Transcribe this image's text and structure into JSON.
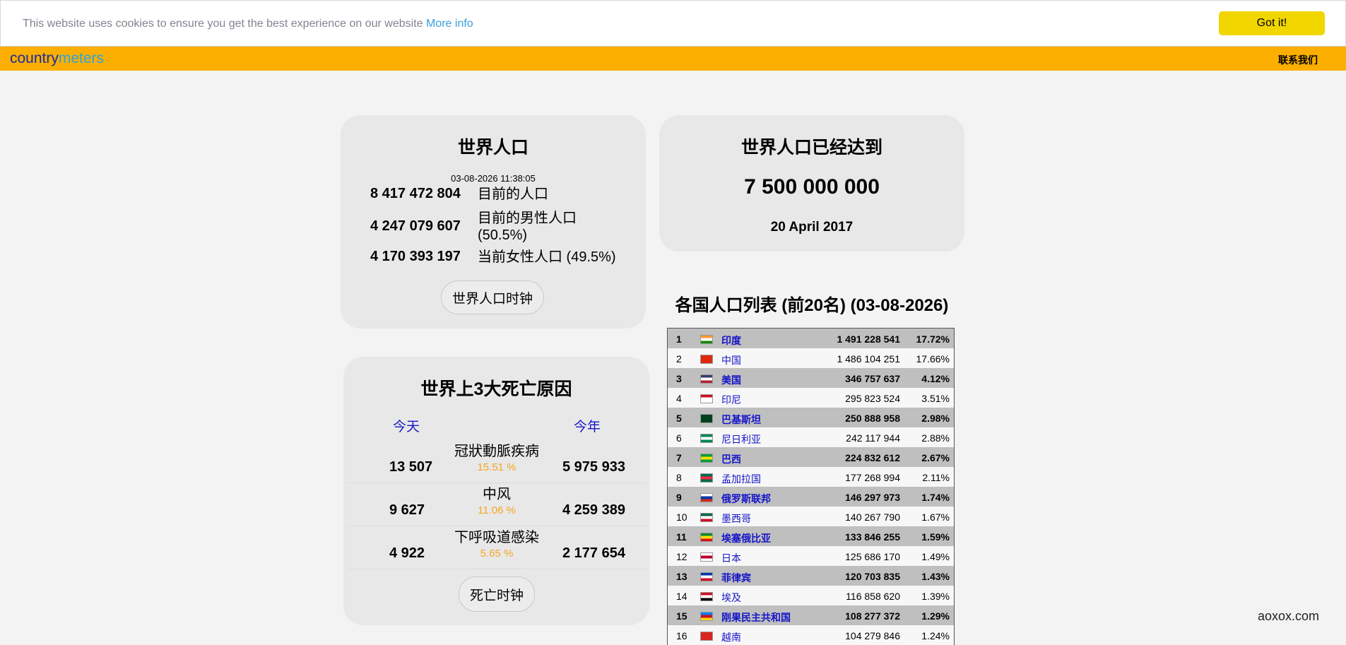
{
  "cookie": {
    "text": "This website uses cookies to ensure you get the best experience on our website",
    "more_info": "More info",
    "button": "Got it!"
  },
  "header": {
    "logo_part1": "country",
    "logo_part2": "meters",
    "contact": "联系我们"
  },
  "world_population": {
    "title": "世界人口",
    "datetime": "03-08-2026 11:38:05",
    "rows": [
      {
        "value": "8 417 472 804",
        "label": "目前的人口"
      },
      {
        "value": "4 247 079 607",
        "label": "目前的男性人口 (50.5%)"
      },
      {
        "value": "4 170 393 197",
        "label": "当前女性人口 (49.5%)"
      }
    ],
    "clock_button": "世界人口时钟"
  },
  "reached": {
    "title": "世界人口已经达到",
    "value": "7 500 000 000",
    "date": "20 April 2017"
  },
  "deaths": {
    "title": "世界上3大死亡原因",
    "today_label": "今天",
    "year_label": "今年",
    "causes": [
      {
        "name": "冠狀動脈疾病",
        "today": "13 507",
        "pct": "15.51 %",
        "year": "5 975 933"
      },
      {
        "name": "中风",
        "today": "9 627",
        "pct": "11.06 %",
        "year": "4 259 389"
      },
      {
        "name": "下呼吸道感染",
        "today": "4 922",
        "pct": "5.65 %",
        "year": "2 177 654"
      }
    ],
    "clock_button": "死亡时钟"
  },
  "country_list": {
    "title": "各国人口列表 (前20名) (03-08-2026)",
    "rows": [
      {
        "rank": "1",
        "flag": "india-flag",
        "name": "印度",
        "population": "1 491 228 541",
        "percent": "17.72%",
        "flag_colors": [
          "#ff9933",
          "#ffffff",
          "#138808"
        ]
      },
      {
        "rank": "2",
        "flag": "china-flag",
        "name": "中国",
        "population": "1 486 104 251",
        "percent": "17.66%",
        "flag_colors": [
          "#de2910",
          "#de2910",
          "#de2910"
        ]
      },
      {
        "rank": "3",
        "flag": "usa-flag",
        "name": "美国",
        "population": "346 757 637",
        "percent": "4.12%",
        "flag_colors": [
          "#3c3b6e",
          "#ffffff",
          "#b22234"
        ]
      },
      {
        "rank": "4",
        "flag": "indonesia-flag",
        "name": "印尼",
        "population": "295 823 524",
        "percent": "3.51%",
        "flag_colors": [
          "#ce1126",
          "#ffffff",
          "#ffffff"
        ]
      },
      {
        "rank": "5",
        "flag": "pakistan-flag",
        "name": "巴基斯坦",
        "population": "250 888 958",
        "percent": "2.98%",
        "flag_colors": [
          "#01411c",
          "#01411c",
          "#01411c"
        ]
      },
      {
        "rank": "6",
        "flag": "nigeria-flag",
        "name": "尼日利亚",
        "population": "242 117 944",
        "percent": "2.88%",
        "flag_colors": [
          "#008751",
          "#ffffff",
          "#008751"
        ]
      },
      {
        "rank": "7",
        "flag": "brazil-flag",
        "name": "巴西",
        "population": "224 832 612",
        "percent": "2.67%",
        "flag_colors": [
          "#009c3b",
          "#ffdf00",
          "#009c3b"
        ]
      },
      {
        "rank": "8",
        "flag": "bangladesh-flag",
        "name": "孟加拉国",
        "population": "177 268 994",
        "percent": "2.11%",
        "flag_colors": [
          "#006a4e",
          "#f42a41",
          "#006a4e"
        ]
      },
      {
        "rank": "9",
        "flag": "russia-flag",
        "name": "俄罗斯联邦",
        "population": "146 297 973",
        "percent": "1.74%",
        "flag_colors": [
          "#ffffff",
          "#0039a6",
          "#d52b1e"
        ]
      },
      {
        "rank": "10",
        "flag": "mexico-flag",
        "name": "墨西哥",
        "population": "140 267 790",
        "percent": "1.67%",
        "flag_colors": [
          "#006847",
          "#ffffff",
          "#ce1126"
        ]
      },
      {
        "rank": "11",
        "flag": "ethiopia-flag",
        "name": "埃塞俄比亚",
        "population": "133 846 255",
        "percent": "1.59%",
        "flag_colors": [
          "#078930",
          "#fcdd09",
          "#da121a"
        ]
      },
      {
        "rank": "12",
        "flag": "japan-flag",
        "name": "日本",
        "population": "125 686 170",
        "percent": "1.49%",
        "flag_colors": [
          "#ffffff",
          "#bc002d",
          "#ffffff"
        ]
      },
      {
        "rank": "13",
        "flag": "philippines-flag",
        "name": "菲律宾",
        "population": "120 703 835",
        "percent": "1.43%",
        "flag_colors": [
          "#0038a8",
          "#ffffff",
          "#ce1126"
        ]
      },
      {
        "rank": "14",
        "flag": "egypt-flag",
        "name": "埃及",
        "population": "116 858 620",
        "percent": "1.39%",
        "flag_colors": [
          "#ce1126",
          "#ffffff",
          "#000000"
        ]
      },
      {
        "rank": "15",
        "flag": "drcongo-flag",
        "name": "刚果民主共和国",
        "population": "108 277 372",
        "percent": "1.29%",
        "flag_colors": [
          "#007fff",
          "#ce1021",
          "#f7d618"
        ]
      },
      {
        "rank": "16",
        "flag": "vietnam-flag",
        "name": "越南",
        "population": "104 279 846",
        "percent": "1.24%",
        "flag_colors": [
          "#da251d",
          "#da251d",
          "#da251d"
        ]
      }
    ]
  },
  "watermark": "aoxox.com"
}
